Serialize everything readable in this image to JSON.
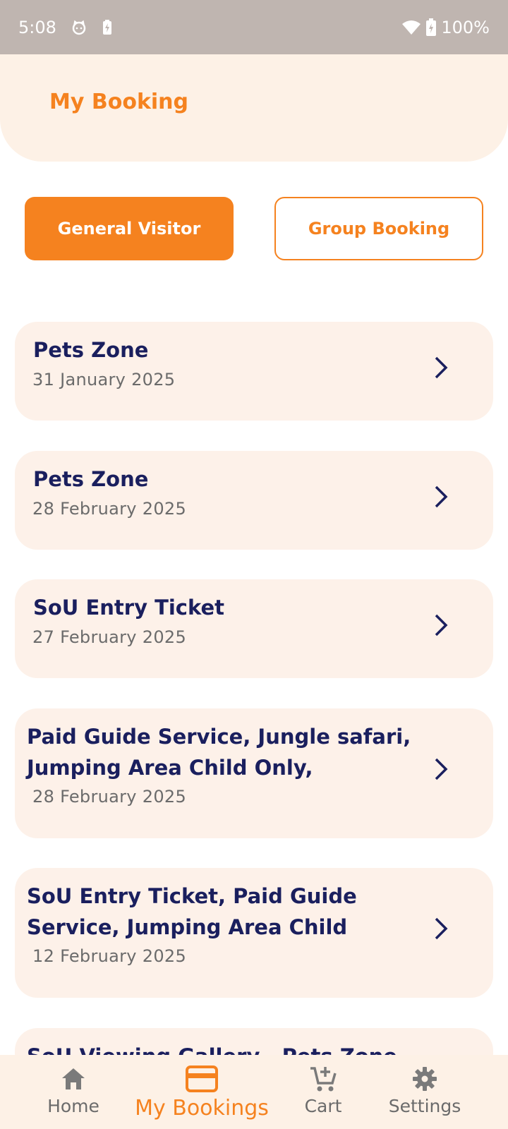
{
  "status_bar": {
    "time": "5:08",
    "battery": "100%",
    "icons": [
      "cat-face-icon",
      "battery-charging-icon",
      "wifi-icon",
      "battery-icon"
    ]
  },
  "header": {
    "title": "My Booking"
  },
  "tabs": {
    "general_label": "General Visitor",
    "group_label": "Group Booking",
    "selected": "General Visitor"
  },
  "bookings": [
    {
      "title": "Pets Zone",
      "date": "31 January 2025"
    },
    {
      "title": "Pets Zone",
      "date": "28 February 2025"
    },
    {
      "title": "SoU Entry Ticket",
      "date": "27 February 2025"
    },
    {
      "title": "Paid Guide Service, Jungle safari, Jumping Area Child Only,",
      "date": "28 February 2025"
    },
    {
      "title": " SoU Entry Ticket, Paid Guide Service, Jumping Area Child",
      "date": "12 February 2025"
    },
    {
      "title": "SoU Viewing Gallery , Pets Zone",
      "date": ""
    }
  ],
  "bottom_nav": {
    "items": [
      {
        "label": "Home",
        "icon": "home-icon"
      },
      {
        "label": "My Bookings",
        "icon": "card-icon"
      },
      {
        "label": "Cart",
        "icon": "cart-add-icon"
      },
      {
        "label": "Settings",
        "icon": "gear-icon"
      }
    ],
    "active": "My Bookings"
  },
  "colors": {
    "accent": "#f5821f",
    "title_text": "#1a1f5e",
    "card_bg": "#fdf1e9",
    "header_bg": "#fdf1e6",
    "status_bar_bg": "#bfb5b0"
  }
}
